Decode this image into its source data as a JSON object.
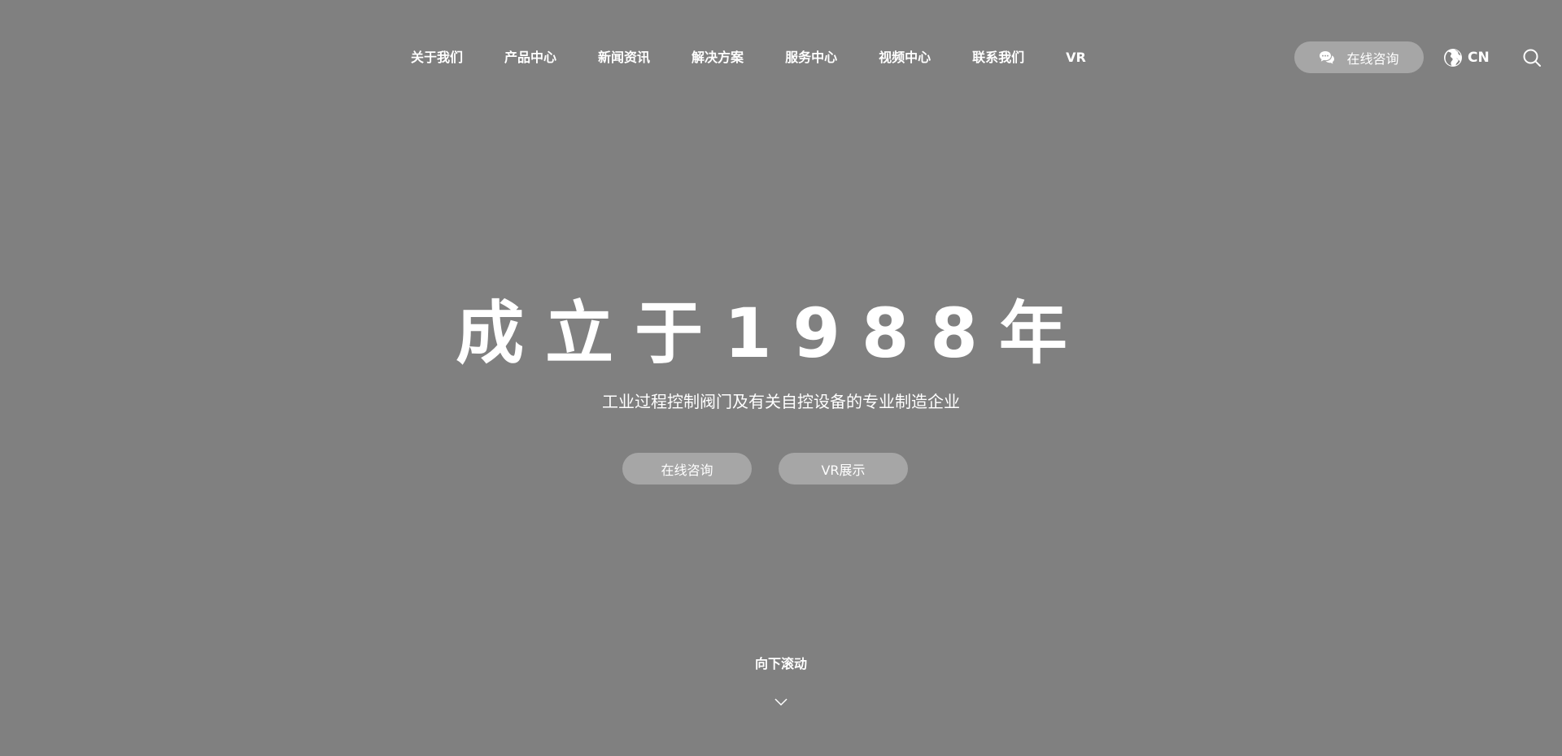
{
  "header": {
    "nav_items": [
      {
        "label": "关于我们"
      },
      {
        "label": "产品中心"
      },
      {
        "label": "新闻资讯"
      },
      {
        "label": "解决方案"
      },
      {
        "label": "服务中心"
      },
      {
        "label": "视频中心"
      },
      {
        "label": "联系我们"
      },
      {
        "label": "VR"
      }
    ],
    "consult_label": "在线咨询",
    "consult_icon": "chat-bubbles-icon",
    "language_label": "CN",
    "language_icon": "globe-icon",
    "search_icon": "search-icon"
  },
  "hero": {
    "title": "成立于1988年",
    "subtitle": "工业过程控制阀门及有关自控设备的专业制造企业",
    "buttons": [
      {
        "label": "在线咨询"
      },
      {
        "label": "VR展示"
      }
    ]
  },
  "scroll_hint": {
    "label": "向下滚动",
    "icon": "chevron-down-icon"
  },
  "colors": {
    "background": "#808080",
    "button_bg": "#a6a6a6",
    "text": "#ffffff"
  }
}
